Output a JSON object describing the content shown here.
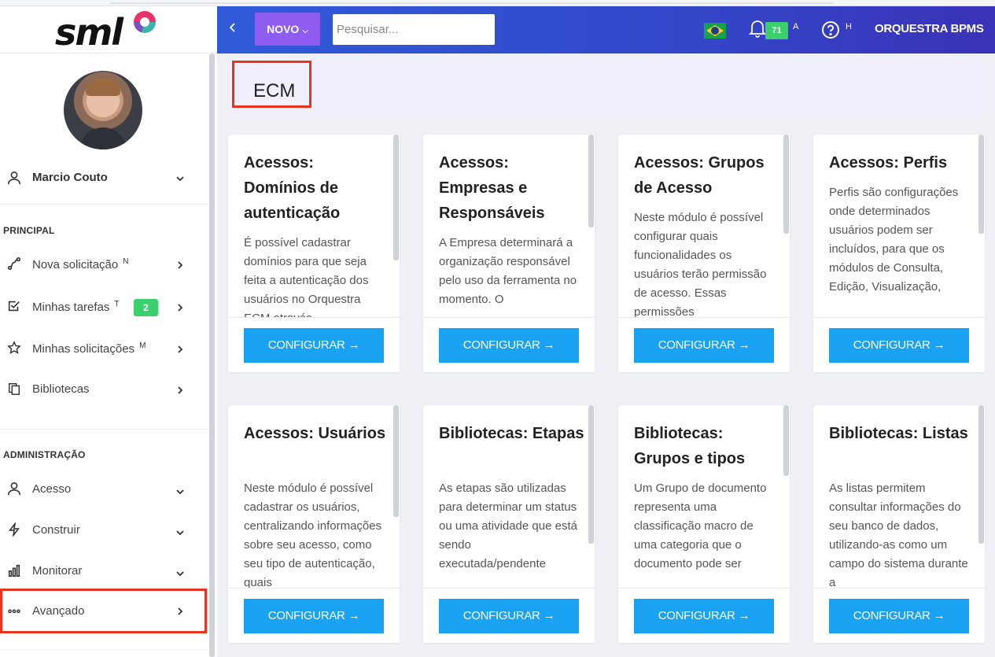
{
  "app": {
    "brand": "sml",
    "org_name": "ORQUESTRA BPMS"
  },
  "header": {
    "novo_label": "NOVO",
    "search_placeholder": "Pesquisar...",
    "notifications_count": "71",
    "notifications_shortcut": "A",
    "help_shortcut": "H"
  },
  "sidebar": {
    "user_name": "Marcio Couto",
    "sections": [
      {
        "label": "PRINCIPAL",
        "items": [
          {
            "label": "Nova solicitação",
            "shortcut": "N",
            "badge": "",
            "icon": "route-icon"
          },
          {
            "label": "Minhas tarefas",
            "shortcut": "T",
            "badge": "2",
            "icon": "checkbox-icon"
          },
          {
            "label": "Minhas solicitações",
            "shortcut": "M",
            "badge": "",
            "icon": "star-icon"
          },
          {
            "label": "Bibliotecas",
            "shortcut": "",
            "badge": "",
            "icon": "copy-icon"
          }
        ]
      },
      {
        "label": "ADMINISTRAÇÃO",
        "items": [
          {
            "label": "Acesso",
            "icon": "user-icon"
          },
          {
            "label": "Construir",
            "icon": "bolt-icon"
          },
          {
            "label": "Monitorar",
            "icon": "bar-chart-icon"
          },
          {
            "label": "Avançado",
            "icon": "dots-icon"
          }
        ]
      }
    ]
  },
  "main": {
    "page_title": "ECM",
    "button_label": "CONFIGURAR",
    "cards": [
      {
        "title": "Acessos: Domínios de autenticação",
        "desc": "É possível cadastrar domínios para que seja feita a autenticação dos usuários no Orquestra ECM através"
      },
      {
        "title": "Acessos: Empresas e Responsáveis",
        "desc": "A Empresa determinará a organização responsável pelo uso da ferramenta no momento. O"
      },
      {
        "title": "Acessos: Grupos de Acesso",
        "desc": "Neste módulo é possível configurar quais funcionalidades os usuários terão permissão de acesso. Essas permissões"
      },
      {
        "title": "Acessos: Perfis",
        "desc": "Perfis são configurações onde determinados usuários podem ser incluídos, para que os módulos de Consulta, Edição, Visualização,"
      },
      {
        "title": "Acessos: Usuários",
        "desc": "Neste módulo é possível cadastrar os usuários, centralizando informações sobre seu acesso, como seu tipo de autenticação, quais"
      },
      {
        "title": "Bibliotecas: Etapas",
        "desc": "As etapas são utilizadas para determinar um status ou uma atividade que está sendo executada/pendente"
      },
      {
        "title": "Bibliotecas: Grupos e tipos",
        "desc": "Um Grupo de documento representa uma classificação macro de uma categoria que o documento pode ser"
      },
      {
        "title": "Bibliotecas: Listas",
        "desc": "As listas permitem consultar informações do seu banco de dados, utilizando-as como um campo do sistema durante a"
      }
    ]
  },
  "colors": {
    "header_start": "#2f5bd9",
    "header_end": "#3a32b8",
    "novo_button": "#8e5cf0",
    "config_button": "#19a3f2",
    "badge_green": "#3ccf6e",
    "highlight_red": "#e8331e"
  }
}
